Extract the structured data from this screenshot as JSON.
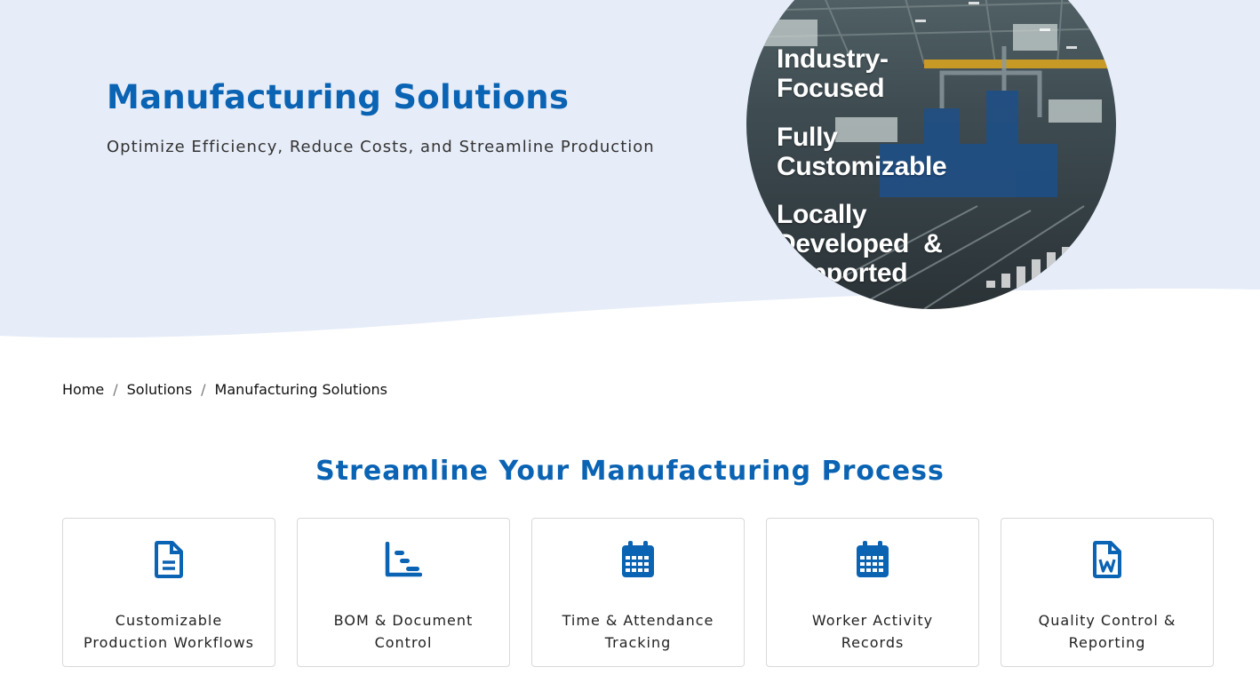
{
  "hero": {
    "title": "Manufacturing Solutions",
    "subtitle": "Optimize Efficiency, Reduce Costs, and Streamline Production",
    "features": [
      {
        "line1": "Industry-",
        "line2": "Focused",
        "line3": ""
      },
      {
        "line1": "Fully",
        "line2": "Customizable",
        "line3": ""
      },
      {
        "line1": "Locally",
        "line2": "Developed  &",
        "line3": "Supported"
      }
    ],
    "bg_color": "#e6ecf8",
    "accent_color": "#0a63b3"
  },
  "breadcrumb": {
    "items": [
      "Home",
      "Solutions",
      "Manufacturing Solutions"
    ],
    "separator": "/"
  },
  "section": {
    "title": "Streamline Your Manufacturing Process",
    "cards": [
      {
        "icon": "document-icon",
        "line1": "Customizable",
        "line2": "Production Workflows"
      },
      {
        "icon": "gantt-chart-icon",
        "line1": "BOM & Document",
        "line2": "Control"
      },
      {
        "icon": "calendar-icon",
        "line1": "Time & Attendance",
        "line2": "Tracking"
      },
      {
        "icon": "calendar-icon",
        "line1": "Worker Activity",
        "line2": "Records"
      },
      {
        "icon": "word-file-icon",
        "line1": "Quality Control &",
        "line2": "Reporting"
      }
    ]
  }
}
